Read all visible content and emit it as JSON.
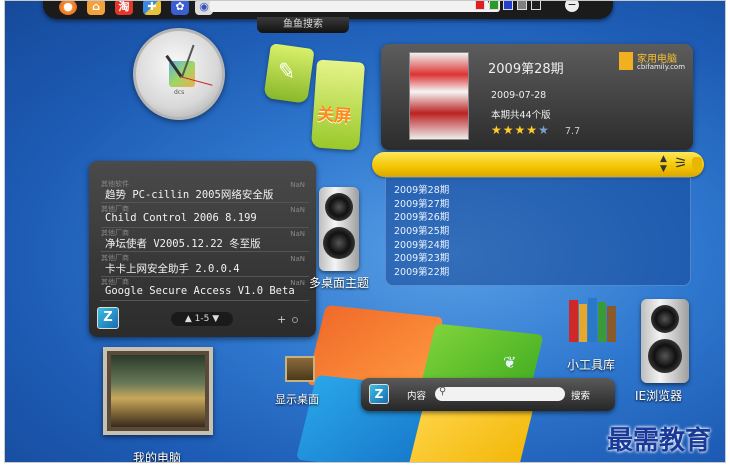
{
  "toolbar": {
    "search_tab": "鱼鱼搜索",
    "quick_icons": [
      "firefox-icon",
      "home-icon",
      "taobao-icon",
      "puzzle-icon",
      "paw-icon",
      "swirl-icon"
    ],
    "swatches": [
      "#e02020",
      "#2a9a2a",
      "#2040d0",
      "#808080",
      "#202020"
    ],
    "close_glyph": "−"
  },
  "clock": {
    "brand": "dcs"
  },
  "tags": {
    "tag2_label": "关屏"
  },
  "magazine": {
    "title": "2009第28期",
    "date": "2009-07-28",
    "count": "本期共44个版",
    "rating_score": "7.7",
    "rating_stars": 4,
    "brand_name": "家用电脑",
    "brand_site": "cbifamily.com",
    "issues": [
      "2009第28期",
      "2009第27期",
      "2009第26期",
      "2009第25期",
      "2009第24期",
      "2009第23期",
      "2009第22期"
    ]
  },
  "software": {
    "items": [
      {
        "category": "其他软件",
        "name": "趋势 PC-cillin 2005网络安全版",
        "tag": "NaN"
      },
      {
        "category": "其他厂商",
        "name": "Child Control 2006 8.199",
        "tag": "NaN"
      },
      {
        "category": "其他厂商",
        "name": "净坛使者 V2005.12.22 冬至版",
        "tag": "NaN"
      },
      {
        "category": "其他厂商",
        "name": "卡卡上网安全助手 2.0.0.4",
        "tag": "NaN"
      },
      {
        "category": "其他厂商",
        "name": "Google Secure Access V1.0 Beta",
        "tag": "NaN"
      }
    ],
    "pager": "1-5",
    "add_glyph": "+"
  },
  "desktop": {
    "theme_label": "多桌面主题",
    "show_desktop": "显示桌面",
    "my_computer": "我的电脑",
    "tools": "小工具库",
    "ie": "IE浏览器"
  },
  "search_widget": {
    "content_label": "内容",
    "search_button": "搜索"
  },
  "watermark": "最需教育",
  "colors": {
    "accent_yellow": "#f2c400",
    "panel_dark": "#2c2c2c",
    "desktop_blue": "#2f78cf"
  }
}
